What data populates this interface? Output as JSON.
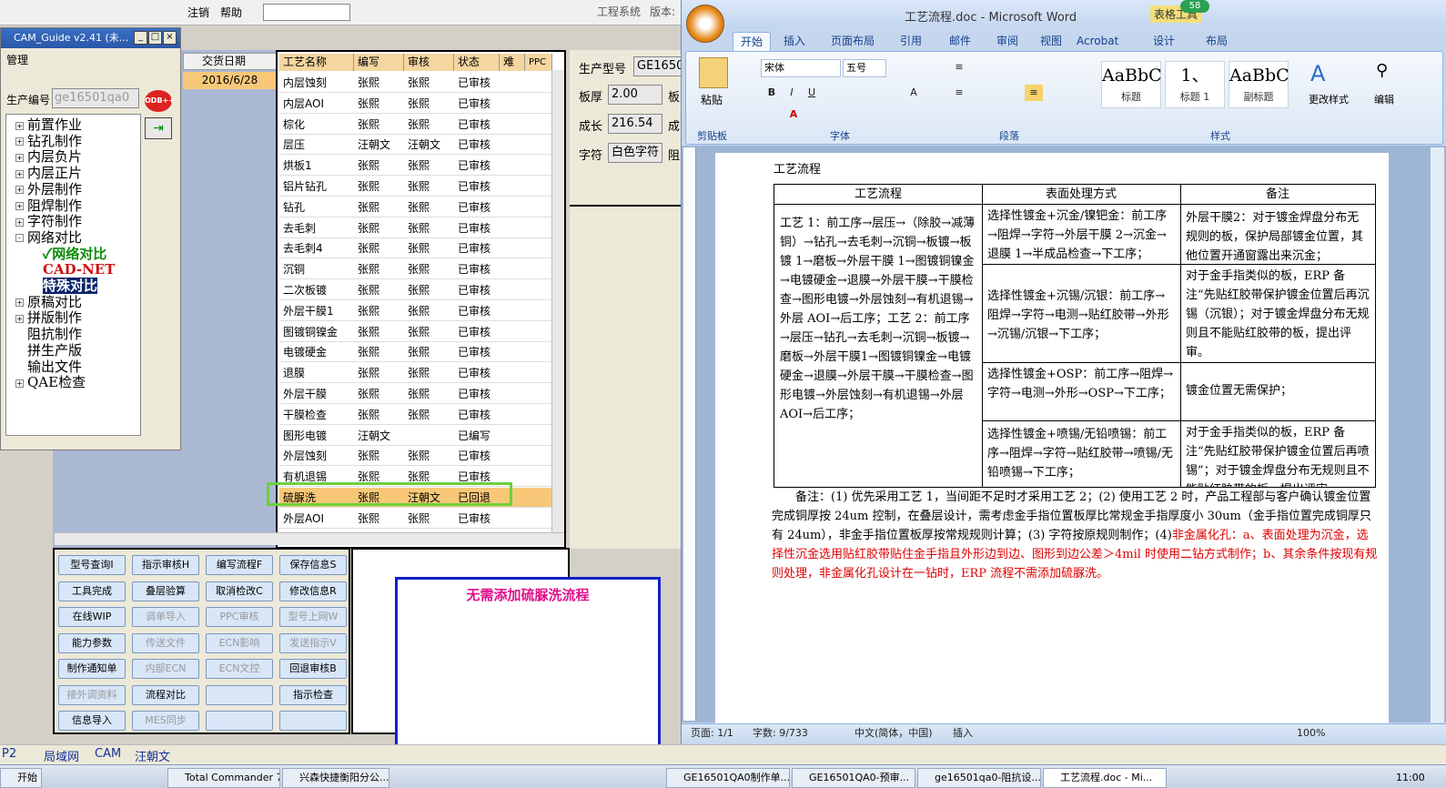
{
  "app": {
    "title": "工程系统",
    "version_label": "版本:",
    "menus": [
      "注销",
      "帮助"
    ]
  },
  "cam": {
    "title": "CAM_Guide v2.41 (未...",
    "manage": "管理",
    "prod_label": "生产编号",
    "prod_value": "ge16501qa0",
    "odb": "ODB++",
    "tree": [
      {
        "label": "前置作业",
        "exp": "+"
      },
      {
        "label": "钻孔制作",
        "exp": "+"
      },
      {
        "label": "内层负片",
        "exp": "+"
      },
      {
        "label": "内层正片",
        "exp": "+"
      },
      {
        "label": "外层制作",
        "exp": "+"
      },
      {
        "label": "阻焊制作",
        "exp": "+"
      },
      {
        "label": "字符制作",
        "exp": "+"
      },
      {
        "label": "网络对比",
        "exp": "-"
      },
      {
        "label": "✓网络对比",
        "exp": ""
      },
      {
        "label": "CAD-NET",
        "exp": ""
      },
      {
        "label": "特殊对比",
        "exp": ""
      },
      {
        "label": "原稿对比",
        "exp": "+"
      },
      {
        "label": "拼版制作",
        "exp": "+"
      },
      {
        "label": "阻抗制作",
        "exp": ""
      },
      {
        "label": "拼生产版",
        "exp": ""
      },
      {
        "label": "输出文件",
        "exp": ""
      },
      {
        "label": "QAE检查",
        "exp": "+"
      }
    ]
  },
  "date_col": {
    "header": "交货日期",
    "value": "2016/6/28"
  },
  "grid": {
    "headers": [
      "工艺名称",
      "编写",
      "审核",
      "状态",
      "难",
      "PPC"
    ],
    "rows": [
      [
        "内层蚀刻",
        "张熙",
        "张熙",
        "已审核"
      ],
      [
        "内层AOI",
        "张熙",
        "张熙",
        "已审核"
      ],
      [
        "棕化",
        "张熙",
        "张熙",
        "已审核"
      ],
      [
        "层压",
        "汪朝文",
        "汪朝文",
        "已审核"
      ],
      [
        "烘板1",
        "张熙",
        "张熙",
        "已审核"
      ],
      [
        "铝片钻孔",
        "张熙",
        "张熙",
        "已审核"
      ],
      [
        "钻孔",
        "张熙",
        "张熙",
        "已审核"
      ],
      [
        "去毛刺",
        "张熙",
        "张熙",
        "已审核"
      ],
      [
        "去毛刺4",
        "张熙",
        "张熙",
        "已审核"
      ],
      [
        "沉铜",
        "张熙",
        "张熙",
        "已审核"
      ],
      [
        "二次板镀",
        "张熙",
        "张熙",
        "已审核"
      ],
      [
        "外层干膜1",
        "张熙",
        "张熙",
        "已审核"
      ],
      [
        "图镀铜镍金",
        "张熙",
        "张熙",
        "已审核"
      ],
      [
        "电镀硬金",
        "张熙",
        "张熙",
        "已审核"
      ],
      [
        "退膜",
        "张熙",
        "张熙",
        "已审核"
      ],
      [
        "外层干膜",
        "张熙",
        "张熙",
        "已审核"
      ],
      [
        "干膜检查",
        "张熙",
        "张熙",
        "已审核"
      ],
      [
        "图形电镀",
        "汪朝文",
        "",
        "已编写"
      ],
      [
        "外层蚀刻",
        "张熙",
        "张熙",
        "已审核"
      ],
      [
        "有机退锡",
        "张熙",
        "张熙",
        "已审核"
      ],
      [
        "硫脲洗",
        "张熙",
        "汪朝文",
        "已回退"
      ],
      [
        "外层AOI",
        "张熙",
        "张熙",
        "已审核"
      ]
    ]
  },
  "info": {
    "rows": [
      {
        "label": "生产型号",
        "value": "GE1650"
      },
      {
        "label": "板厚",
        "value": "2.00"
      },
      {
        "label": "成长",
        "value": "216.54"
      },
      {
        "label": "字符",
        "value": "白色字符"
      }
    ],
    "trail": [
      "板",
      "成",
      "阻"
    ]
  },
  "buttons": [
    [
      "型号查询I",
      "指示审核H",
      "编写流程F",
      "保存信息S"
    ],
    [
      "工具完成",
      "叠层验算",
      "取消检改C",
      "修改信息R"
    ],
    [
      "在线WIP",
      "调单导入",
      "PPC审核",
      "型号上网W"
    ],
    [
      "能力参数",
      "传送文件",
      "ECN影响",
      "发送指示V"
    ],
    [
      "制作通知单",
      "内部ECN",
      "ECN文控",
      "回退审核B"
    ],
    [
      "接外调资料",
      "流程对比",
      "",
      "指示检查"
    ],
    [
      "信息导入",
      "MES同步",
      "",
      ""
    ]
  ],
  "disabled": [
    "调单导入",
    "PPC审核",
    "型号上网W",
    "传送文件",
    "ECN影响",
    "发送指示V",
    "内部ECN",
    "ECN文控",
    "接外调资料",
    "MES同步"
  ],
  "note": "无需添加硫脲洗流程",
  "left_status": [
    "P2",
    "局域网",
    "CAM",
    "汪朝文"
  ],
  "word": {
    "title": "工艺流程.doc - Microsoft Word",
    "context_tab": "表格工具",
    "badge": "58",
    "tabs": [
      "开始",
      "插入",
      "页面布局",
      "引用",
      "邮件",
      "审阅",
      "视图",
      "Acrobat",
      "设计",
      "布局"
    ],
    "font": "宋体",
    "size": "五号",
    "groups": [
      "剪贴板",
      "字体",
      "段落",
      "样式"
    ],
    "styles": [
      {
        "big": "AaBbC",
        "sm": "标题"
      },
      {
        "big": "1、",
        "sm": "标题 1"
      },
      {
        "big": "AaBbC",
        "sm": "副标题"
      }
    ],
    "paste": "粘贴",
    "change_style": "更改样式",
    "edit": "编辑",
    "doc": {
      "heading": "工艺流程",
      "cols": [
        "工艺流程",
        "表面处理方式",
        "备注"
      ],
      "flow": "工艺 1：前工序→层压→（除胶→减薄铜）→钻孔→去毛刺→沉铜→板镀→板镀 1→磨板→外层干膜 1→图镀铜镍金→电镀硬金→退膜→外层干膜→干膜检查→图形电镀→外层蚀刻→有机退锡→外层 AOI→后工序；工艺 2：前工序→层压→钻孔→去毛刺→沉铜→板镀→磨板→外层干膜1→图镀铜镍金→电镀硬金→退膜→外层干膜→干膜检查→图形电镀→外层蚀刻→有机退锡→外层 AOI→后工序；",
      "surf": [
        "选择性镀金+沉金/镍钯金：前工序→阻焊→字符→外层干膜 2→沉金→退膜 1→半成品检查→下工序；",
        "选择性镀金+沉锡/沉银：前工序→阻焊→字符→电测→贴红胶带→外形→沉锡/沉银→下工序；",
        "选择性镀金+OSP：前工序→阻焊→字符→电测→外形→OSP→下工序；",
        "选择性镀金+喷锡/无铅喷锡：前工序→阻焊→字符→贴红胶带→喷锡/无铅喷锡→下工序；"
      ],
      "remarks": [
        "外层干膜2：对于镀金焊盘分布无规则的板，保护局部镀金位置，其他位置开通窗露出来沉金；",
        "对于金手指类似的板，ERP 备注“先贴红胶带保护镀金位置后再沉锡（沉银）；对于镀金焊盘分布无规则且不能贴红胶带的板，提出评审。",
        "镀金位置无需保护；",
        "对于金手指类似的板，ERP 备注“先贴红胶带保护镀金位置后再喷锡”；对于镀金焊盘分布无规则且不能贴红胶带的板，提出评审。"
      ],
      "note_black": "备注：(1) 优先采用工艺 1，当间距不足时才采用工艺 2；(2) 使用工艺 2 时，产品工程部与客户确认镀金位置完成铜厚按 24um 控制，在叠层设计，需考虑金手指位置板厚比常规金手指厚度小 30um（金手指位置完成铜厚只有 24um），非金手指位置板厚按常规规则计算；(3) 字符按原规则制作；(4)",
      "note_red": "非金属化孔：a、表面处理为沉金，选择性沉金选用贴红胶带贴住金手指且外形边到边、图形到边公差＞4mil 时使用二钻方式制作；b、其余条件按现有规则处理，非金属化孔设计在一钻时，ERP 流程不需添加硫脲洗。"
    },
    "status": {
      "page": "页面: 1/1",
      "words": "字数: 9/733",
      "lang": "中文(简体，中国)",
      "mode": "插入",
      "zoom": "100%"
    }
  },
  "taskbar": [
    "开始",
    "Total Commander 7...",
    "兴森快捷衡阳分公...",
    "GE16501QA0制作单...",
    "GE16501QA0-预审...",
    "ge16501qa0-阻抗设...",
    "工艺流程.doc - Mi..."
  ],
  "clock": "11:00"
}
